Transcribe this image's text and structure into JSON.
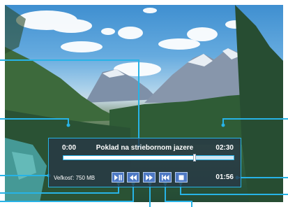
{
  "player": {
    "title": "Poklad na striebornom jazere",
    "start_time": "0:00",
    "end_time": "02:30",
    "elapsed_time": "01:56",
    "size_label": "Veľkosť: 750 MB",
    "progress": 0.77
  },
  "controls": [
    {
      "name": "play-pause-button",
      "icon": "play-pause-icon"
    },
    {
      "name": "rewind-button",
      "icon": "rewind-icon"
    },
    {
      "name": "fast-forward-button",
      "icon": "fast-forward-icon"
    },
    {
      "name": "previous-button",
      "icon": "skip-back-icon"
    },
    {
      "name": "stop-button",
      "icon": "stop-icon"
    }
  ],
  "colors": {
    "accent": "#27b3e6",
    "button": "#4e79c4",
    "panel": "#28374b"
  }
}
